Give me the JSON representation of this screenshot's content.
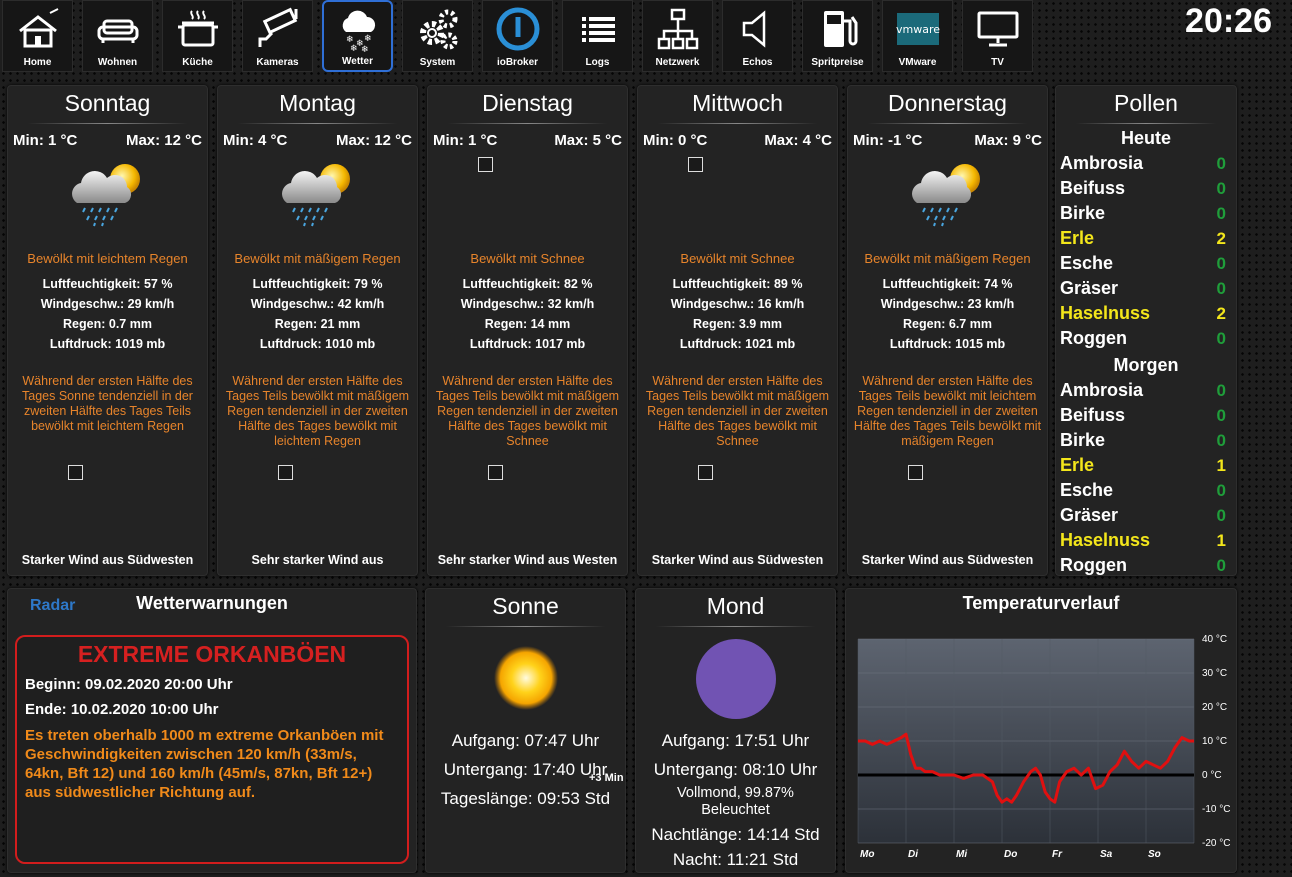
{
  "nav": [
    {
      "label": "Home",
      "icon": "home-icon"
    },
    {
      "label": "Wohnen",
      "icon": "sofa-icon"
    },
    {
      "label": "Küche",
      "icon": "cooking-pot-icon"
    },
    {
      "label": "Kameras",
      "icon": "security-camera-icon"
    },
    {
      "label": "Wetter",
      "icon": "weather-snow-cloud-icon",
      "active": true
    },
    {
      "label": "System",
      "icon": "gears-icon"
    },
    {
      "label": "ioBroker",
      "icon": "iobroker-logo-icon"
    },
    {
      "label": "Logs",
      "icon": "list-icon"
    },
    {
      "label": "Netzwerk",
      "icon": "network-icon"
    },
    {
      "label": "Echos",
      "icon": "speaker-icon"
    },
    {
      "label": "Spritpreise",
      "icon": "fuel-pump-icon"
    },
    {
      "label": "VMware",
      "icon": "vmware-logo-icon"
    },
    {
      "label": "TV",
      "icon": "monitor-icon"
    }
  ],
  "clock": "20:26",
  "days": [
    {
      "name": "Sonntag",
      "min": "Min: 1 °C",
      "max": "Max: 12 °C",
      "icon": "cloud-sun-rain-icon",
      "desc": "Bewölkt mit leichtem Regen",
      "humidity": "Luftfeuchtigkeit: 57 %",
      "windspeed": "Windgeschw.: 29 km/h",
      "rain": "Regen: 0.7 mm",
      "pressure": "Luftdruck: 1019 mb",
      "long": "Während der ersten Hälfte des Tages Sonne tendenziell in der zweiten Hälfte des Tages Teils bewölkt mit leichtem Regen",
      "wind": "Starker Wind aus Südwesten"
    },
    {
      "name": "Montag",
      "min": "Min: 4 °C",
      "max": "Max: 12 °C",
      "icon": "cloud-sun-rain-icon",
      "desc": "Bewölkt mit mäßigem Regen",
      "humidity": "Luftfeuchtigkeit: 79 %",
      "windspeed": "Windgeschw.: 42 km/h",
      "rain": "Regen: 21 mm",
      "pressure": "Luftdruck: 1010 mb",
      "long": "Während der ersten Hälfte des Tages Teils bewölkt mit mäßigem Regen tendenziell in der zweiten Hälfte des Tages bewölkt mit leichtem Regen",
      "wind": "Sehr starker Wind aus"
    },
    {
      "name": "Dienstag",
      "min": "Min: 1 °C",
      "max": "Max: 5 °C",
      "icon": null,
      "desc": "Bewölkt mit Schnee",
      "humidity": "Luftfeuchtigkeit: 82 %",
      "windspeed": "Windgeschw.: 32 km/h",
      "rain": "Regen: 14 mm",
      "pressure": "Luftdruck: 1017 mb",
      "long": "Während der ersten Hälfte des Tages Teils bewölkt mit mäßigem Regen tendenziell in der zweiten Hälfte des Tages bewölkt mit Schnee",
      "wind": "Sehr starker Wind aus Westen"
    },
    {
      "name": "Mittwoch",
      "min": "Min: 0 °C",
      "max": "Max: 4 °C",
      "icon": null,
      "desc": "Bewölkt mit Schnee",
      "humidity": "Luftfeuchtigkeit: 89 %",
      "windspeed": "Windgeschw.: 16 km/h",
      "rain": "Regen: 3.9 mm",
      "pressure": "Luftdruck: 1021 mb",
      "long": "Während der ersten Hälfte des Tages Teils bewölkt mit mäßigem Regen tendenziell in der zweiten Hälfte des Tages bewölkt mit Schnee",
      "wind": "Starker Wind aus Südwesten"
    },
    {
      "name": "Donnerstag",
      "min": "Min: -1 °C",
      "max": "Max: 9 °C",
      "icon": "cloud-sun-rain-icon",
      "desc": "Bewölkt mit mäßigem Regen",
      "humidity": "Luftfeuchtigkeit: 74 %",
      "windspeed": "Windgeschw.: 23 km/h",
      "rain": "Regen: 6.7 mm",
      "pressure": "Luftdruck: 1015 mb",
      "long": "Während der ersten Hälfte des Tages Teils bewölkt mit leichtem Regen tendenziell in der zweiten Hälfte des Tages Teils bewölkt mit mäßigem Regen",
      "wind": "Starker Wind aus Südwesten"
    }
  ],
  "pollen": {
    "title": "Pollen",
    "today_label": "Heute",
    "tomorrow_label": "Morgen",
    "today": [
      {
        "name": "Ambrosia",
        "value": "0"
      },
      {
        "name": "Beifuss",
        "value": "0"
      },
      {
        "name": "Birke",
        "value": "0"
      },
      {
        "name": "Erle",
        "value": "2",
        "high": true
      },
      {
        "name": "Esche",
        "value": "0"
      },
      {
        "name": "Gräser",
        "value": "0"
      },
      {
        "name": "Haselnuss",
        "value": "2",
        "high": true
      },
      {
        "name": "Roggen",
        "value": "0"
      }
    ],
    "tomorrow": [
      {
        "name": "Ambrosia",
        "value": "0"
      },
      {
        "name": "Beifuss",
        "value": "0"
      },
      {
        "name": "Birke",
        "value": "0"
      },
      {
        "name": "Erle",
        "value": "1",
        "high": true
      },
      {
        "name": "Esche",
        "value": "0"
      },
      {
        "name": "Gräser",
        "value": "0"
      },
      {
        "name": "Haselnuss",
        "value": "1",
        "high": true
      },
      {
        "name": "Roggen",
        "value": "0"
      }
    ]
  },
  "warning": {
    "radar_label": "Radar",
    "title": "Wetterwarnungen",
    "headline": "EXTREME ORKANBÖEN",
    "begin": "Beginn: 09.02.2020 20:00 Uhr",
    "end": "Ende: 10.02.2020 10:00 Uhr",
    "text": "Es treten oberhalb 1000 m extreme Orkanböen mit Geschwindigkeiten zwischen 120 km/h (33m/s, 64kn, Bft 12) und 160 km/h (45m/s, 87kn, Bft 12+) aus südwestlicher Richtung auf."
  },
  "sun": {
    "title": "Sonne",
    "rise": "Aufgang: 07:47 Uhr",
    "set": "Untergang: 17:40 Uhr",
    "delta": "+3 Min",
    "daylength": "Tageslänge: 09:53 Std"
  },
  "moon": {
    "title": "Mond",
    "rise": "Aufgang: 17:51 Uhr",
    "set": "Untergang: 08:10 Uhr",
    "phase": "Vollmond, 99.87%",
    "lit": "Beleuchtet",
    "nightlength": "Nachtlänge: 14:14 Std",
    "night": "Nacht: 11:21 Std",
    "color": "#7153b3"
  },
  "colors": {
    "accent_orange": "#e7842b",
    "warn_red": "#d21d1d",
    "pollen_green": "#1f9e3a",
    "pollen_yellow": "#f3e61b",
    "nav_active": "#2f6fd6"
  },
  "chart_data": {
    "type": "line",
    "title": "Temperaturverlauf",
    "x_ticks": [
      "Mo",
      "Di",
      "Mi",
      "Do",
      "Fr",
      "Sa",
      "So"
    ],
    "y_ticks": [
      "40 °C",
      "30 °C",
      "20 °C",
      "10 °C",
      "0 °C",
      "-10 °C",
      "-20 °C"
    ],
    "ylim": [
      -20,
      40
    ],
    "xlim": [
      0,
      7
    ],
    "grid": true,
    "series": [
      {
        "color": "#e01010",
        "x": [
          0,
          0.15,
          0.3,
          0.45,
          0.6,
          0.75,
          0.9,
          1.0,
          1.1,
          1.2,
          1.3,
          1.4,
          1.55,
          1.7,
          1.85,
          2.0,
          2.2,
          2.4,
          2.6,
          2.8,
          2.9,
          3.0,
          3.1,
          3.2,
          3.3,
          3.45,
          3.6,
          3.7,
          3.8,
          3.9,
          4.0,
          4.1,
          4.2,
          4.35,
          4.5,
          4.65,
          4.8,
          4.95,
          5.1,
          5.25,
          5.4,
          5.55,
          5.7,
          5.85,
          6.0,
          6.15,
          6.3,
          6.45,
          6.6,
          6.75,
          6.9,
          7.0
        ],
        "y": [
          10,
          10,
          9,
          10,
          9,
          10,
          11,
          12,
          6,
          2,
          2,
          1,
          1,
          0,
          0,
          0,
          -1,
          0,
          0,
          -2,
          -6,
          -8,
          -7,
          -8,
          -6,
          -2,
          1,
          2,
          0,
          -5,
          -7,
          -8,
          -2,
          1,
          2,
          0,
          2,
          -4,
          -3,
          1,
          3,
          7,
          4,
          2,
          4,
          3,
          2,
          4,
          8,
          11,
          10,
          10
        ]
      }
    ]
  }
}
